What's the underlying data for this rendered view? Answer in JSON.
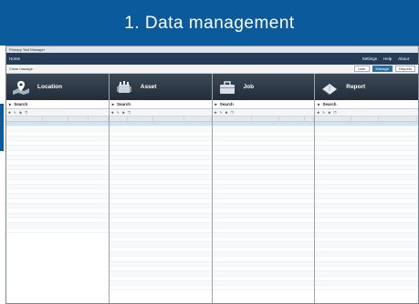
{
  "banner": {
    "title": "1. Data management"
  },
  "window": {
    "title": "Primary Test Manager"
  },
  "toolbar": {
    "home": "Home",
    "settings": "Settings",
    "help": "Help",
    "about": "About"
  },
  "subbar": {
    "close": "Close manage",
    "user": "User",
    "manage": "Manage",
    "reports": "Reports"
  },
  "panels": {
    "location": {
      "title": "Location",
      "search": "Search"
    },
    "asset": {
      "title": "Asset",
      "search": "Search"
    },
    "job": {
      "title": "Job",
      "search": "Search"
    },
    "report": {
      "title": "Report",
      "search": "Search"
    }
  },
  "colors": {
    "banner": "#0a5a9c",
    "panel_header": "#2c3844",
    "toolbar": "#243c55"
  },
  "icons": [
    "location-map-icon",
    "asset-transformer-icon",
    "job-briefcase-icon",
    "report-folder-icon",
    "search-arrow-icon"
  ]
}
